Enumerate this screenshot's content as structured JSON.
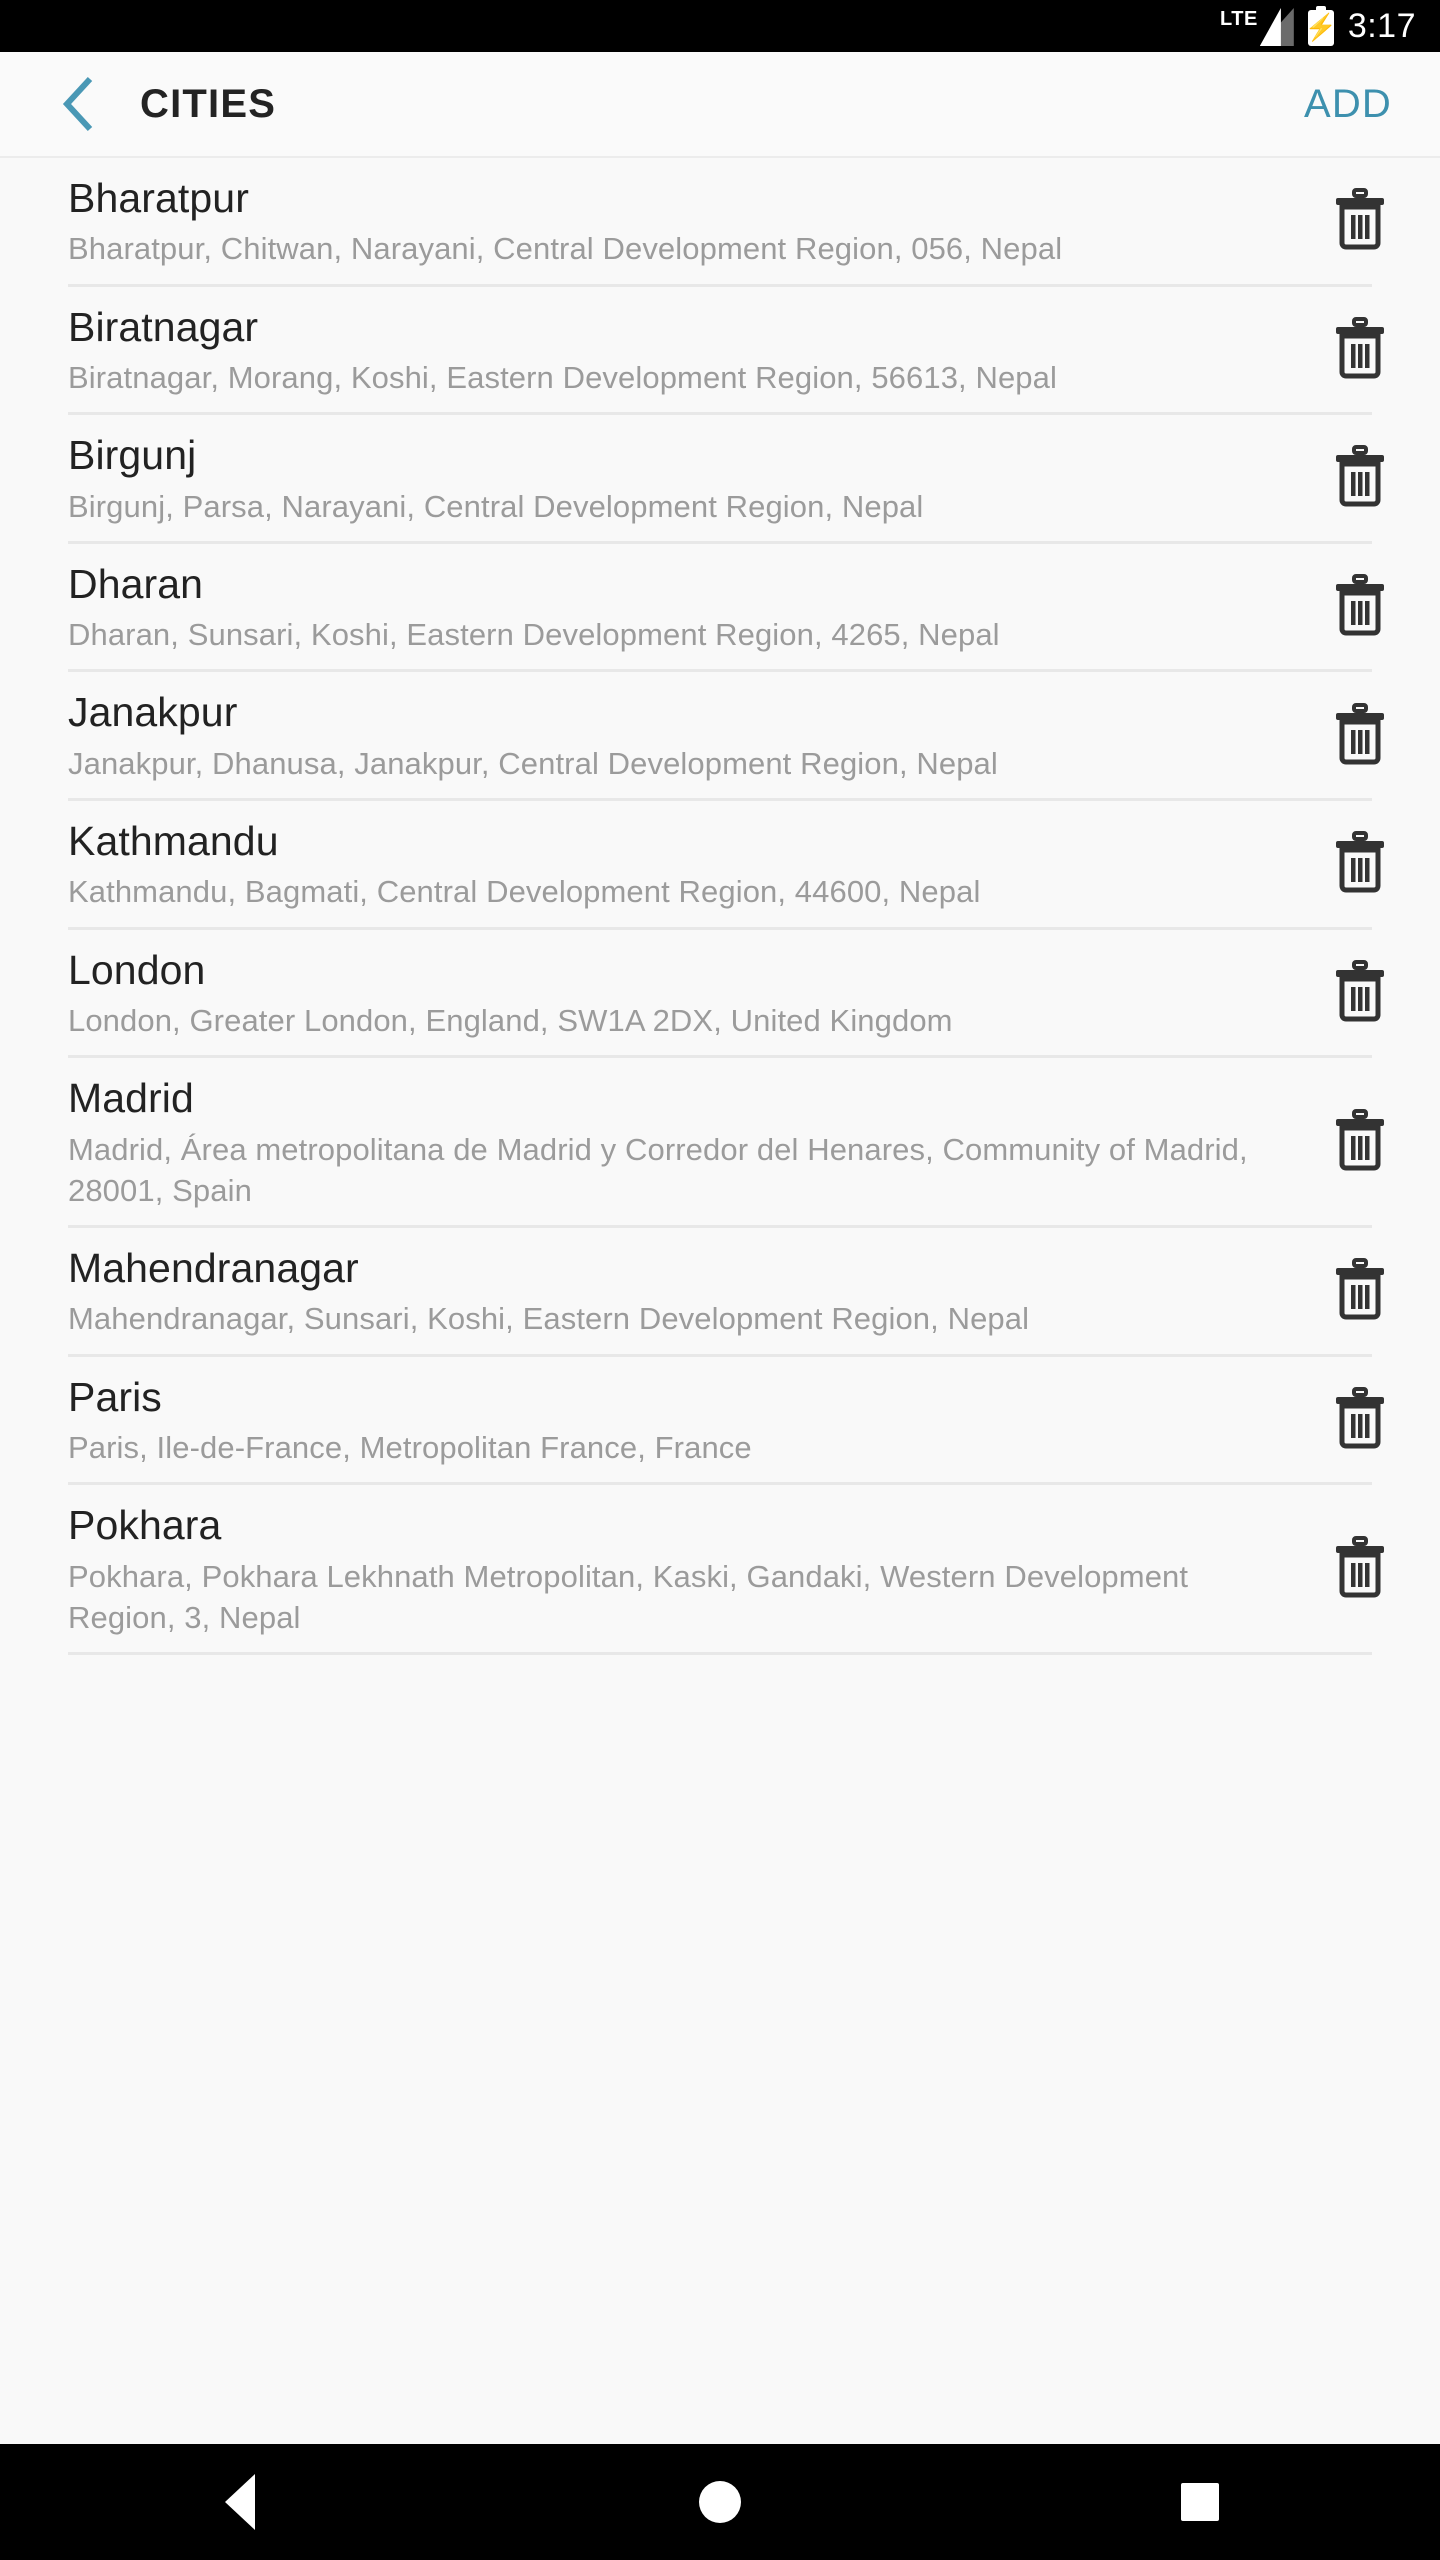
{
  "status_bar": {
    "network_label": "LTE",
    "signal_icon": "signal-bars-icon",
    "battery_icon": "battery-charging-icon",
    "time": "3:17"
  },
  "app_bar": {
    "back_icon": "chevron-left-icon",
    "title": "CITIES",
    "add_label": "ADD",
    "accent_color": "#3d90ae"
  },
  "list": {
    "delete_icon": "trash-icon",
    "items": [
      {
        "name": "Bharatpur",
        "address": "Bharatpur, Chitwan, Narayani, Central Development Region, 056, Nepal"
      },
      {
        "name": "Biratnagar",
        "address": "Biratnagar, Morang, Koshi, Eastern Development Region, 56613, Nepal"
      },
      {
        "name": "Birgunj",
        "address": "Birgunj, Parsa, Narayani, Central Development Region, Nepal"
      },
      {
        "name": "Dharan",
        "address": "Dharan, Sunsari, Koshi, Eastern Development Region, 4265, Nepal"
      },
      {
        "name": "Janakpur",
        "address": "Janakpur, Dhanusa, Janakpur, Central Development Region, Nepal"
      },
      {
        "name": "Kathmandu",
        "address": "Kathmandu, Bagmati, Central Development Region, 44600, Nepal"
      },
      {
        "name": "London",
        "address": "London, Greater London, England, SW1A 2DX, United Kingdom"
      },
      {
        "name": "Madrid",
        "address": "Madrid, Área metropolitana de Madrid y Corredor del Henares, Community of Madrid, 28001, Spain"
      },
      {
        "name": "Mahendranagar",
        "address": "Mahendranagar, Sunsari, Koshi, Eastern Development Region, Nepal"
      },
      {
        "name": "Paris",
        "address": "Paris, Ile-de-France, Metropolitan France, France"
      },
      {
        "name": "Pokhara",
        "address": "Pokhara, Pokhara Lekhnath Metropolitan, Kaski, Gandaki, Western Development Region, 3, Nepal"
      }
    ]
  },
  "nav_bar": {
    "back_icon": "triangle-back-icon",
    "home_icon": "circle-home-icon",
    "recents_icon": "square-recents-icon"
  }
}
